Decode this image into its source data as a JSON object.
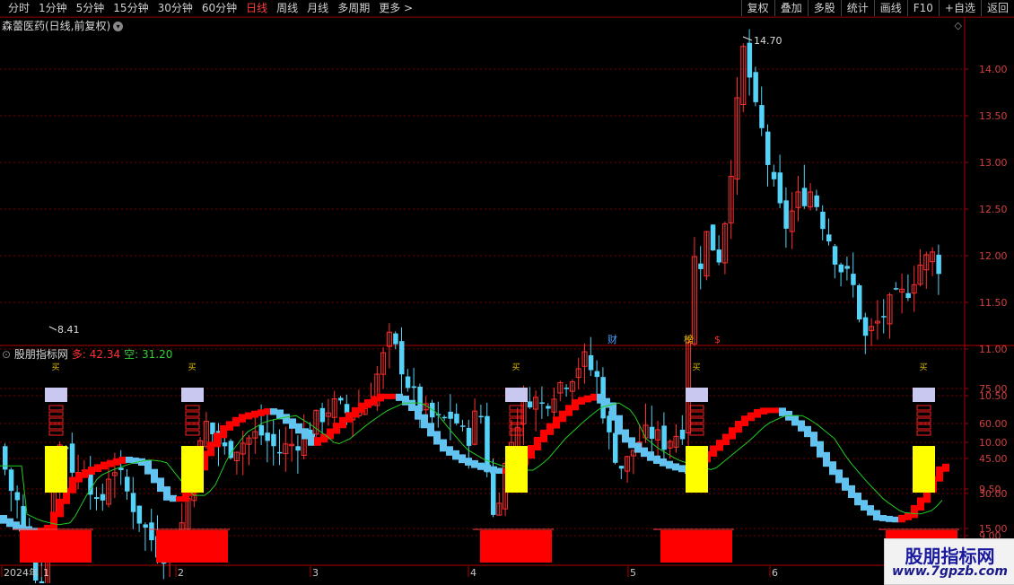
{
  "toolbar": {
    "periods": [
      "分时",
      "1分钟",
      "5分钟",
      "15分钟",
      "30分钟",
      "60分钟",
      "日线",
      "周线",
      "月线",
      "多周期",
      "更多 >"
    ],
    "active_period": "日线",
    "actions": [
      "复权",
      "叠加",
      "多股",
      "统计",
      "画线",
      "F10",
      "+自选",
      "返回"
    ]
  },
  "main_title": "森蕾医药(日线,前复权)",
  "main_markers": {
    "cai": "财",
    "bang": "榜",
    "dollar": "$"
  },
  "price_axis": [
    "14.00",
    "13.50",
    "13.00",
    "12.50",
    "12.00",
    "11.50",
    "11.00",
    "10.50",
    "10.00",
    "9.50",
    "9.00"
  ],
  "high_label": "14.70",
  "low_label": "8.41",
  "indicator": {
    "name": "股朋指标网",
    "duo_label": "多: 42.34",
    "kong_label": "空: 31.20",
    "axis": [
      "75.00",
      "60.00",
      "45.00",
      "30.00",
      "15.00"
    ],
    "signal_char": "买"
  },
  "x_axis": [
    "2024年",
    "1",
    "2",
    "3",
    "4",
    "5",
    "6"
  ],
  "watermark": {
    "title": "股朋指标网",
    "url": "www.7gpzb.com"
  },
  "colors": {
    "up": "#ff3030",
    "down": "#54d2f8",
    "ma": "#22cc22",
    "grid": "#7a0000",
    "accent": "#ff4040"
  }
}
